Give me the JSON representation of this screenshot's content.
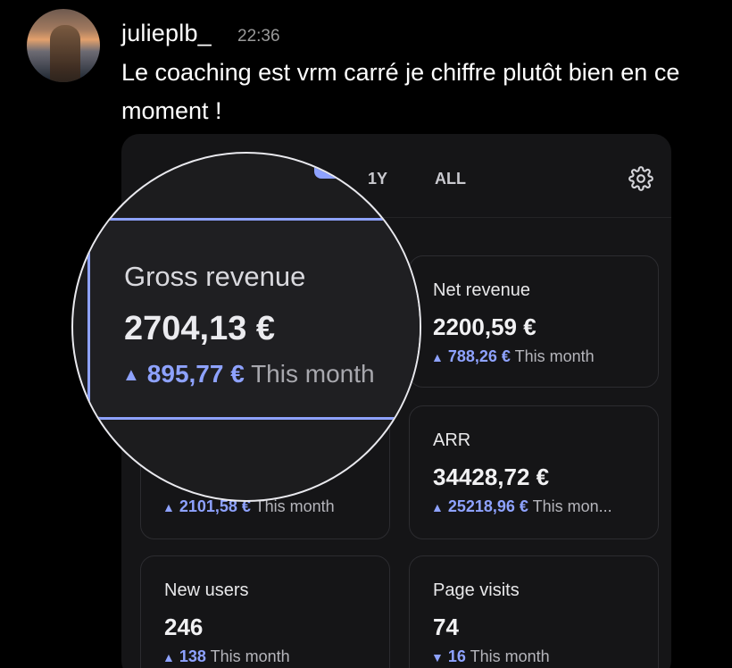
{
  "post": {
    "username": "julieplb_",
    "time": "22:36",
    "message": "Le coaching est vrm carré je chiffre plutôt bien en ce moment !"
  },
  "dashboard": {
    "tabs": [
      "1Y",
      "ALL"
    ],
    "accent_color": "#8ea2ff",
    "cards": {
      "gross": {
        "label": "Gross revenue",
        "value": "2704,13 €",
        "delta": "895,77 €",
        "suffix": "This month",
        "direction": "up"
      },
      "net": {
        "label": "Net revenue",
        "value": "2200,59 €",
        "delta": "788,26 €",
        "suffix": "This month",
        "direction": "up"
      },
      "hidden": {
        "delta": "2101,58 €",
        "suffix": "This month",
        "direction": "up"
      },
      "arr": {
        "label": "ARR",
        "value": "34428,72 €",
        "delta": "25218,96 €",
        "suffix": "This mon...",
        "direction": "up"
      },
      "new_users": {
        "label": "New users",
        "value": "246",
        "delta": "138",
        "suffix": "This month",
        "direction": "up"
      },
      "page_visits": {
        "label": "Page visits",
        "value": "74",
        "delta": "16",
        "suffix": "This month",
        "direction": "down"
      }
    }
  }
}
